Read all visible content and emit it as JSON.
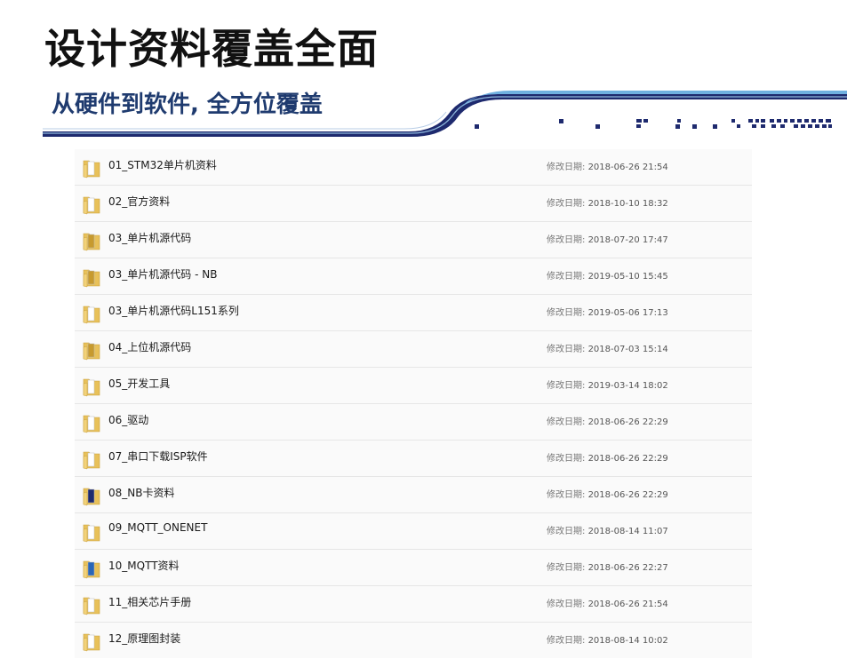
{
  "header": {
    "title": "设计资料覆盖全面",
    "subtitle": "从硬件到软件, 全方位覆盖"
  },
  "colors": {
    "title": "#111111",
    "subtitle": "#1f3b6f",
    "banner_dark": "#1e2a6e",
    "banner_light": "#6fb0e0",
    "folder": "#e8c15a"
  },
  "files": {
    "date_label": "修改日期:",
    "items": [
      {
        "name": "01_STM32单片机资料",
        "date": "2018-06-26 21:54",
        "icon": "folder-icon"
      },
      {
        "name": "02_官方资料",
        "date": "2018-10-10 18:32",
        "icon": "folder-icon"
      },
      {
        "name": "03_单片机源代码",
        "date": "2018-07-20 17:47",
        "icon": "folder-icon"
      },
      {
        "name": "03_单片机源代码 - NB",
        "date": "2019-05-10 15:45",
        "icon": "folder-icon"
      },
      {
        "name": "03_单片机源代码L151系列",
        "date": "2019-05-06 17:13",
        "icon": "folder-icon"
      },
      {
        "name": "04_上位机源代码",
        "date": "2018-07-03 15:14",
        "icon": "folder-icon"
      },
      {
        "name": "05_开发工具",
        "date": "2019-03-14 18:02",
        "icon": "folder-icon"
      },
      {
        "name": "06_驱动",
        "date": "2018-06-26 22:29",
        "icon": "folder-icon"
      },
      {
        "name": "07_串口下载ISP软件",
        "date": "2018-06-26 22:29",
        "icon": "folder-icon"
      },
      {
        "name": "08_NB卡资料",
        "date": "2018-06-26 22:29",
        "icon": "folder-icon"
      },
      {
        "name": "09_MQTT_ONENET",
        "date": "2018-08-14 11:07",
        "icon": "folder-icon"
      },
      {
        "name": "10_MQTT资料",
        "date": "2018-06-26 22:27",
        "icon": "folder-icon"
      },
      {
        "name": "11_相关芯片手册",
        "date": "2018-06-26 21:54",
        "icon": "folder-icon"
      },
      {
        "name": "12_原理图封装",
        "date": "2018-08-14 10:02",
        "icon": "folder-icon"
      }
    ]
  }
}
